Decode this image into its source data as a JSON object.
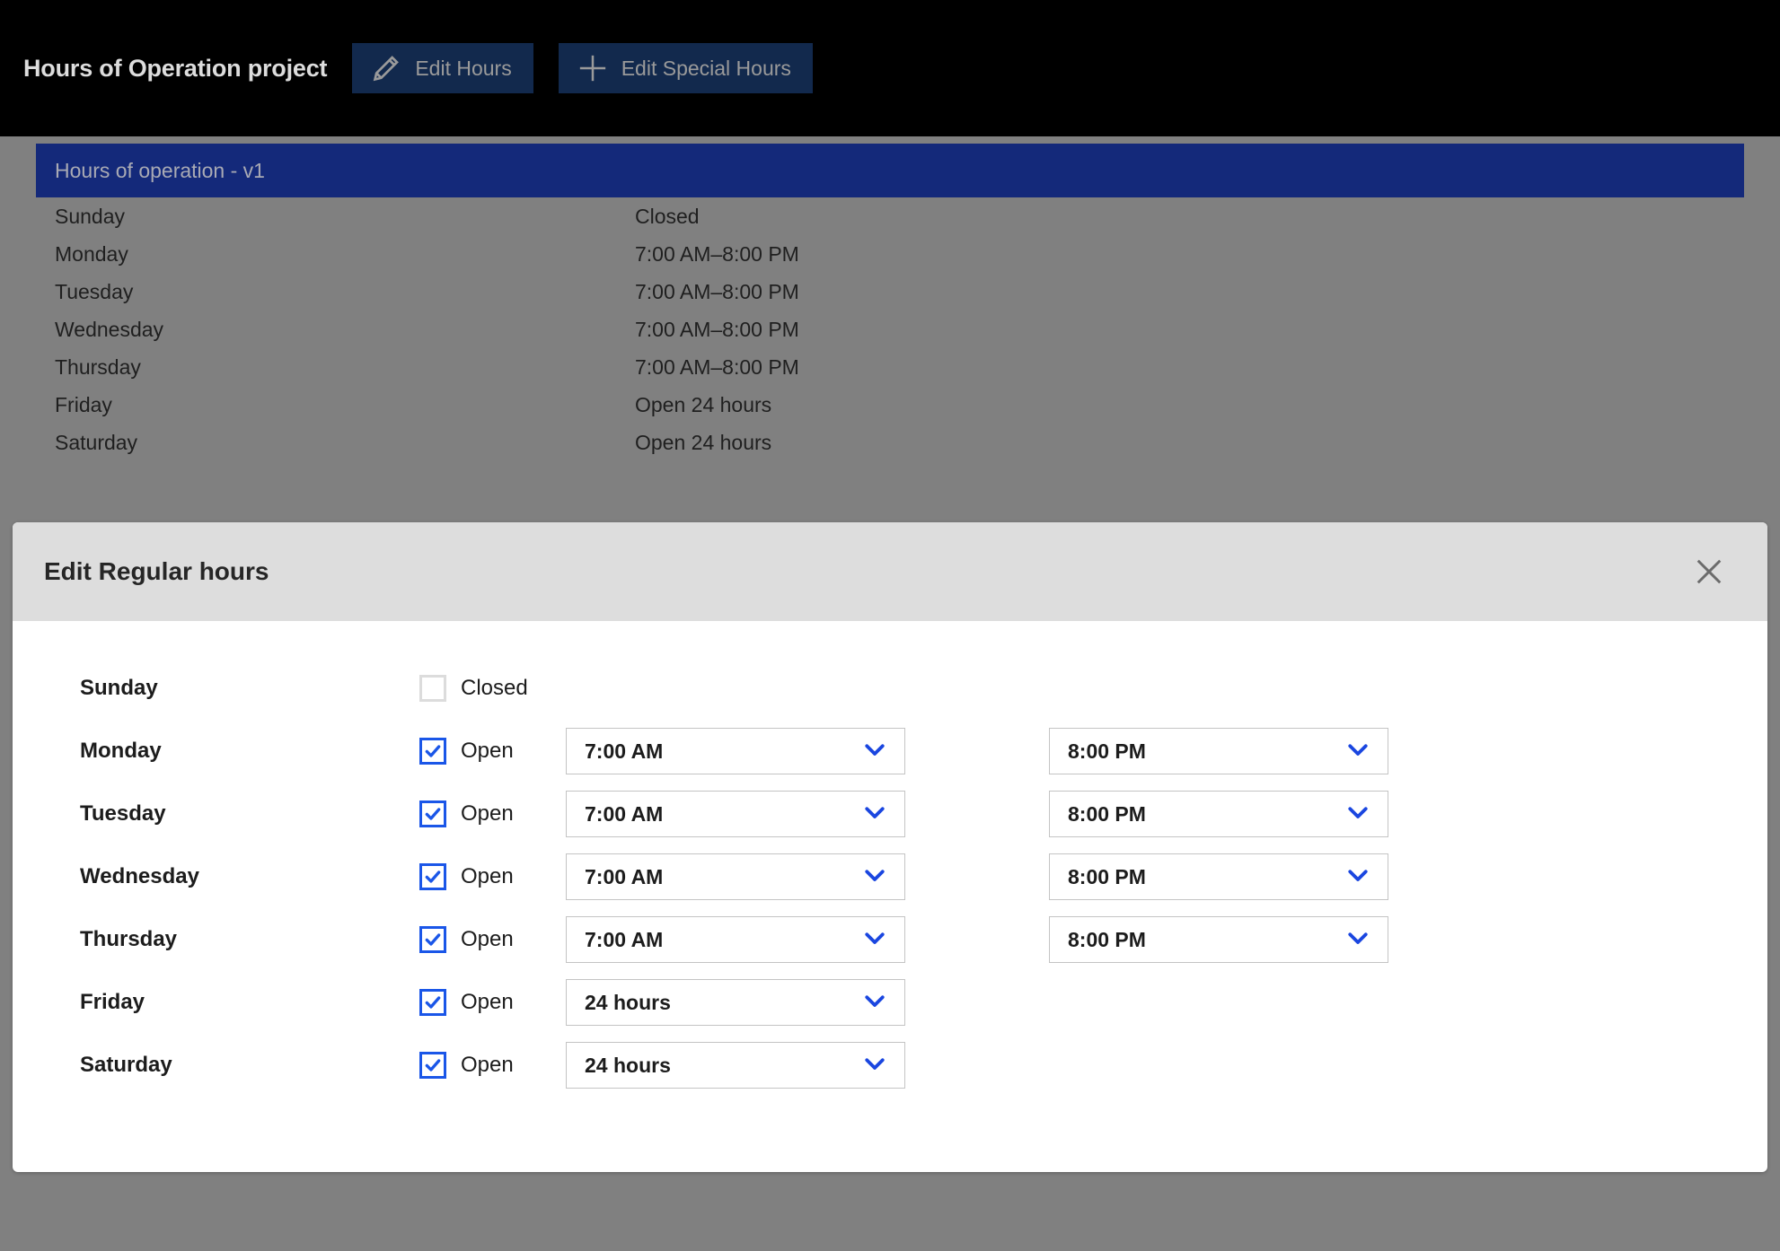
{
  "header": {
    "title": "Hours of Operation project",
    "buttons": [
      {
        "label": "Edit Hours",
        "icon": "pencil-icon"
      },
      {
        "label": "Edit Special Hours",
        "icon": "plus-icon"
      }
    ]
  },
  "behind": {
    "card_title": "Hours of operation - v1",
    "rows": [
      {
        "day": "Sunday",
        "value": "Closed"
      },
      {
        "day": "Monday",
        "value": "7:00 AM–8:00 PM"
      },
      {
        "day": "Tuesday",
        "value": "7:00 AM–8:00 PM"
      },
      {
        "day": "Wednesday",
        "value": "7:00 AM–8:00 PM"
      },
      {
        "day": "Thursday",
        "value": "7:00 AM–8:00 PM"
      },
      {
        "day": "Friday",
        "value": "Open 24 hours"
      },
      {
        "day": "Saturday",
        "value": "Open 24 hours"
      }
    ]
  },
  "modal": {
    "title": "Edit Regular hours",
    "close_icon": "close-icon",
    "rows": [
      {
        "day": "Sunday",
        "checked": false,
        "status": "Closed",
        "open_time": null,
        "close_time": null
      },
      {
        "day": "Monday",
        "checked": true,
        "status": "Open",
        "open_time": "7:00 AM",
        "close_time": "8:00 PM"
      },
      {
        "day": "Tuesday",
        "checked": true,
        "status": "Open",
        "open_time": "7:00 AM",
        "close_time": "8:00 PM"
      },
      {
        "day": "Wednesday",
        "checked": true,
        "status": "Open",
        "open_time": "7:00 AM",
        "close_time": "8:00 PM"
      },
      {
        "day": "Thursday",
        "checked": true,
        "status": "Open",
        "open_time": "7:00 AM",
        "close_time": "8:00 PM"
      },
      {
        "day": "Friday",
        "checked": true,
        "status": "Open",
        "open_time": "24 hours",
        "close_time": null
      },
      {
        "day": "Saturday",
        "checked": true,
        "status": "Open",
        "open_time": "24 hours",
        "close_time": null
      }
    ]
  },
  "colors": {
    "topbar_bg": "#000000",
    "button_bg": "#12294d",
    "card_header_bg": "#14297a",
    "overlay_gray": "#808080",
    "modal_header_bg": "#dddddd",
    "accent_blue": "#1a56e8",
    "chevron_blue": "#1a46e0"
  }
}
